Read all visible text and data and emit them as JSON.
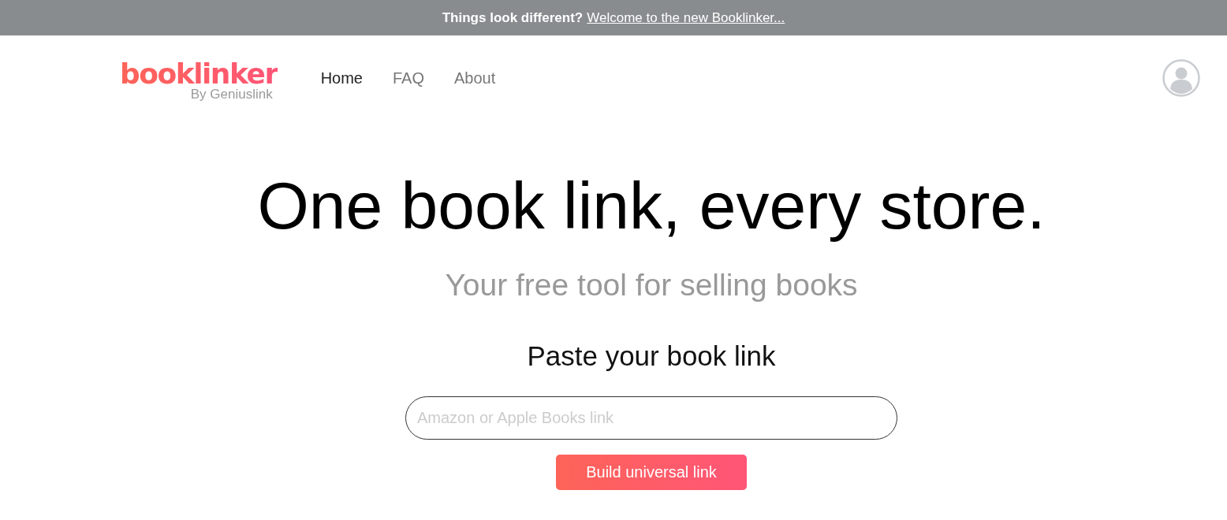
{
  "banner": {
    "lead": "Things look different?",
    "link": "Welcome to the new Booklinker..."
  },
  "logo": {
    "wordmark": "booklinker",
    "byline": "By Geniuslink"
  },
  "nav": [
    {
      "label": "Home",
      "selected": true
    },
    {
      "label": "FAQ",
      "selected": false
    },
    {
      "label": "About",
      "selected": false
    }
  ],
  "hero": {
    "title": "One book link, every store.",
    "subtitle": "Your free tool for selling books"
  },
  "form": {
    "heading": "Paste your book link",
    "placeholder": "Amazon or Apple Books link",
    "button": "Build universal link"
  }
}
